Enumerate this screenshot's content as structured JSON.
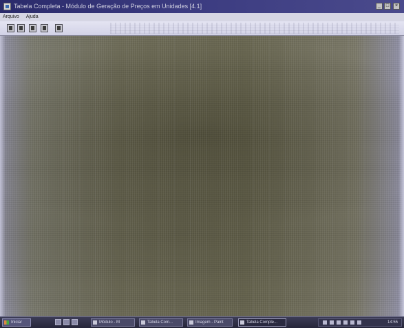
{
  "window": {
    "title": "Tabela Completa - Módulo de Geração de Preços em Unidades [4.1]",
    "controls": {
      "minimize": "_",
      "maximize": "□",
      "close": "×"
    }
  },
  "menu": {
    "items": [
      {
        "label": "Arquivo"
      },
      {
        "label": "Ajuda"
      }
    ]
  },
  "toolbar": {
    "buttons": [
      {
        "icon": "save-icon"
      },
      {
        "icon": "print-icon"
      },
      {
        "icon": "export-icon"
      },
      {
        "icon": "edit-icon"
      },
      {
        "icon": "exit-icon"
      }
    ]
  },
  "taskbar": {
    "start_label": "Iniciar",
    "tasks": [
      {
        "label": "Módulo - M"
      },
      {
        "label": "Tabela Com..."
      },
      {
        "label": "Imagem - Paint"
      },
      {
        "label": "Tabela Comple..."
      }
    ],
    "clock": "14:55"
  },
  "colors": {
    "titlebar": "#3b3b80",
    "workspace": "#6e6c58",
    "taskbar": "#26263a"
  }
}
